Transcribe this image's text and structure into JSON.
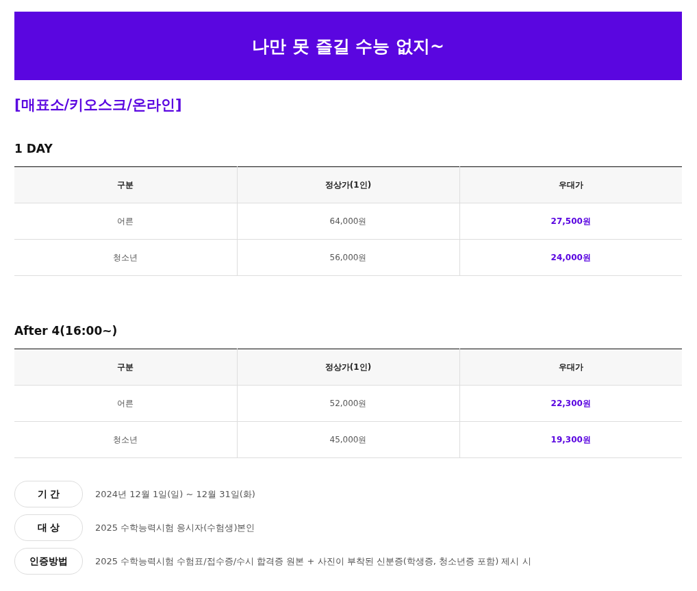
{
  "banner": {
    "title": "나만 못 즐길 수능 없지~"
  },
  "channel_heading": "[매표소/키오스크/온라인]",
  "sections": [
    {
      "title": "1 DAY",
      "columns": [
        "구분",
        "정상가(1인)",
        "우대가"
      ],
      "rows": [
        {
          "cells": [
            "어른",
            "64,000원",
            "27,500원"
          ]
        },
        {
          "cells": [
            "청소년",
            "56,000원",
            "24,000원"
          ]
        }
      ]
    },
    {
      "title": "After 4(16:00~)",
      "columns": [
        "구분",
        "정상가(1인)",
        "우대가"
      ],
      "rows": [
        {
          "cells": [
            "어른",
            "52,000원",
            "22,300원"
          ]
        },
        {
          "cells": [
            "청소년",
            "45,000원",
            "19,300원"
          ]
        }
      ]
    }
  ],
  "info": [
    {
      "label": "기 간",
      "value": "2024년 12월 1일(일) ~ 12월 31일(화)"
    },
    {
      "label": "대 상",
      "value": "2025 수학능력시험 응시자(수험생)본인"
    },
    {
      "label": "인증방법",
      "value": "2025 수학능력시험 수험표/접수증/수시 합격증 원본 + 사진이 부착된 신분증(학생증, 청소년증 포함) 제시 시"
    }
  ]
}
